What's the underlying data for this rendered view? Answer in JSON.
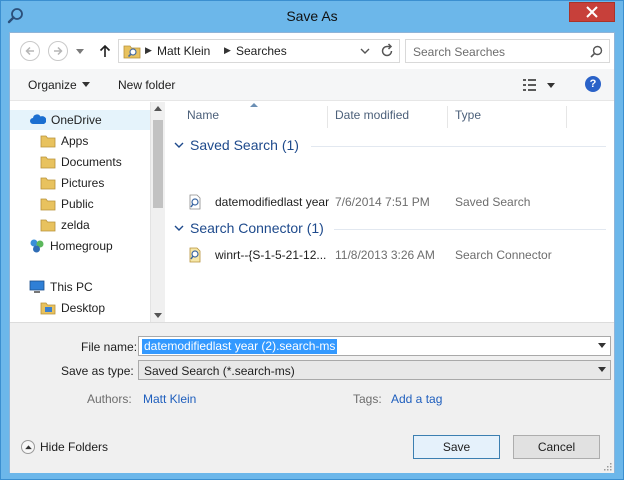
{
  "window": {
    "title": "Save As"
  },
  "address": {
    "crumbs": [
      "Matt Klein",
      "Searches"
    ]
  },
  "search": {
    "placeholder": "Search Searches"
  },
  "toolbar": {
    "organize_label": "Organize",
    "new_folder_label": "New folder"
  },
  "sidebar": {
    "items": [
      {
        "label": "OneDrive",
        "icon": "onedrive-icon",
        "level": 0,
        "selected": true
      },
      {
        "label": "Apps",
        "icon": "folder-icon",
        "level": 1
      },
      {
        "label": "Documents",
        "icon": "folder-icon",
        "level": 1
      },
      {
        "label": "Pictures",
        "icon": "folder-icon",
        "level": 1
      },
      {
        "label": "Public",
        "icon": "folder-icon",
        "level": 1
      },
      {
        "label": "zelda",
        "icon": "folder-icon",
        "level": 1
      },
      {
        "label": "Homegroup",
        "icon": "homegroup-icon",
        "level": 0
      },
      {
        "label": "This PC",
        "icon": "computer-icon",
        "level": 0
      },
      {
        "label": "Desktop",
        "icon": "desktop-folder-icon",
        "level": 1
      }
    ]
  },
  "filelist": {
    "columns": [
      "Name",
      "Date modified",
      "Type"
    ],
    "groups": [
      {
        "header": "Saved Search (1)",
        "rows": [
          {
            "name": "datemodifiedlast year",
            "date": "7/6/2014 7:51 PM",
            "type": "Saved Search",
            "icon": "saved-search-icon"
          }
        ]
      },
      {
        "header": "Search Connector (1)",
        "rows": [
          {
            "name": "winrt--{S-1-5-21-12...",
            "date": "11/8/2013 3:26 AM",
            "type": "Search Connector",
            "icon": "search-connector-icon"
          }
        ]
      }
    ]
  },
  "form": {
    "filename_label": "File name:",
    "filename_value": "datemodifiedlast year (2).search-ms",
    "type_label": "Save as type:",
    "type_value": "Saved Search (*.search-ms)",
    "authors_label": "Authors:",
    "authors_value": "Matt Klein",
    "tags_label": "Tags:",
    "tags_value": "Add a tag"
  },
  "footer": {
    "hide_folders_label": "Hide Folders",
    "save_label": "Save",
    "cancel_label": "Cancel"
  },
  "colors": {
    "frame": "#6cb7ea",
    "close": "#c7403a",
    "link": "#1e5ebd",
    "group_header": "#1e4a8c",
    "selection": "#3399ff"
  }
}
